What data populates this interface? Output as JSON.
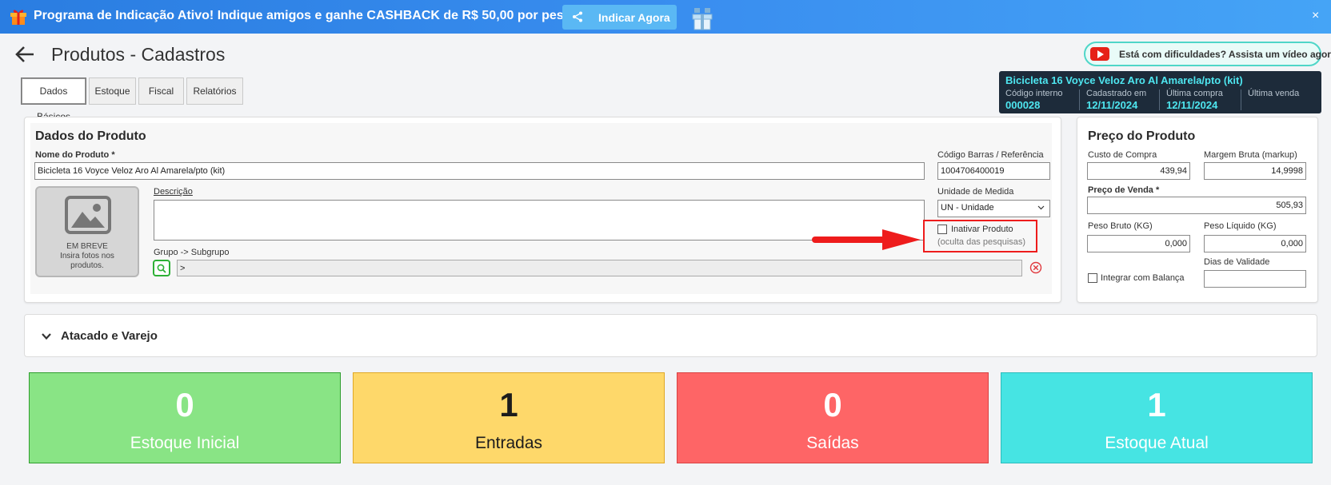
{
  "banner": {
    "text": "Programa de Indicação Ativo! Indique amigos e ganhe CASHBACK de R$ 50,00 por pessoa!",
    "button_label": "Indicar Agora",
    "close": "×"
  },
  "header": {
    "title": "Produtos - Cadastros",
    "help_label": "Está com dificuldades? Assista um vídeo agora!"
  },
  "tabs": [
    {
      "label": "Dados Básicos",
      "active": true
    },
    {
      "label": "Estoque",
      "active": false
    },
    {
      "label": "Fiscal",
      "active": false
    },
    {
      "label": "Relatórios",
      "active": false
    }
  ],
  "summary": {
    "product_name": "Bicicleta 16 Voyce Veloz Aro Al Amarela/pto (kit)",
    "codigo_label": "Código interno",
    "codigo_value": "000028",
    "cadastrado_label": "Cadastrado em",
    "cadastrado_value": "12/11/2024",
    "ultima_compra_label": "Última compra",
    "ultima_compra_value": "12/11/2024",
    "ultima_venda_label": "Última venda"
  },
  "dados_produto": {
    "title": "Dados do Produto",
    "nome_label": "Nome do Produto *",
    "nome_value": "Bicicleta 16 Voyce Veloz Aro Al Amarela/pto (kit)",
    "descricao_label": "Descrição",
    "descricao_value": "",
    "grupo_label": "Grupo -> Subgrupo",
    "grupo_value": ">",
    "codigo_barras_label": "Código Barras / Referência",
    "codigo_barras_value": "1004706400019",
    "unidade_label": "Unidade de Medida",
    "unidade_value": "UN - Unidade",
    "inativar_label": "Inativar Produto",
    "inativar_hint": "(oculta das pesquisas)",
    "photo_title": "EM BREVE",
    "photo_text": "Insira fotos nos produtos."
  },
  "preco_produto": {
    "title": "Preço do Produto",
    "custo_label": "Custo de Compra",
    "custo_value": "439,94",
    "margem_label": "Margem Bruta (markup)",
    "margem_value": "14,9998",
    "venda_label": "Preço de Venda *",
    "venda_value": "505,93",
    "peso_bruto_label": "Peso Bruto (KG)",
    "peso_bruto_value": "0,000",
    "peso_liquido_label": "Peso Líquido (KG)",
    "peso_liquido_value": "0,000",
    "integrar_label": "Integrar com Balança",
    "validade_label": "Dias de Validade",
    "validade_value": ""
  },
  "accordion": {
    "title": "Atacado e Varejo"
  },
  "stats": [
    {
      "value": "0",
      "label": "Estoque Inicial",
      "bg": "#89e485",
      "border": "#2e9e2e",
      "color": "#ffffff"
    },
    {
      "value": "1",
      "label": "Entradas",
      "bg": "#fed86a",
      "border": "#e0a826",
      "color": "#1c1c1c"
    },
    {
      "value": "0",
      "label": "Saídas",
      "bg": "#fe6566",
      "border": "#d84242",
      "color": "#ffffff"
    },
    {
      "value": "1",
      "label": "Estoque Atual",
      "bg": "#46e4e3",
      "border": "#2bbcbc",
      "color": "#ffffff"
    }
  ]
}
